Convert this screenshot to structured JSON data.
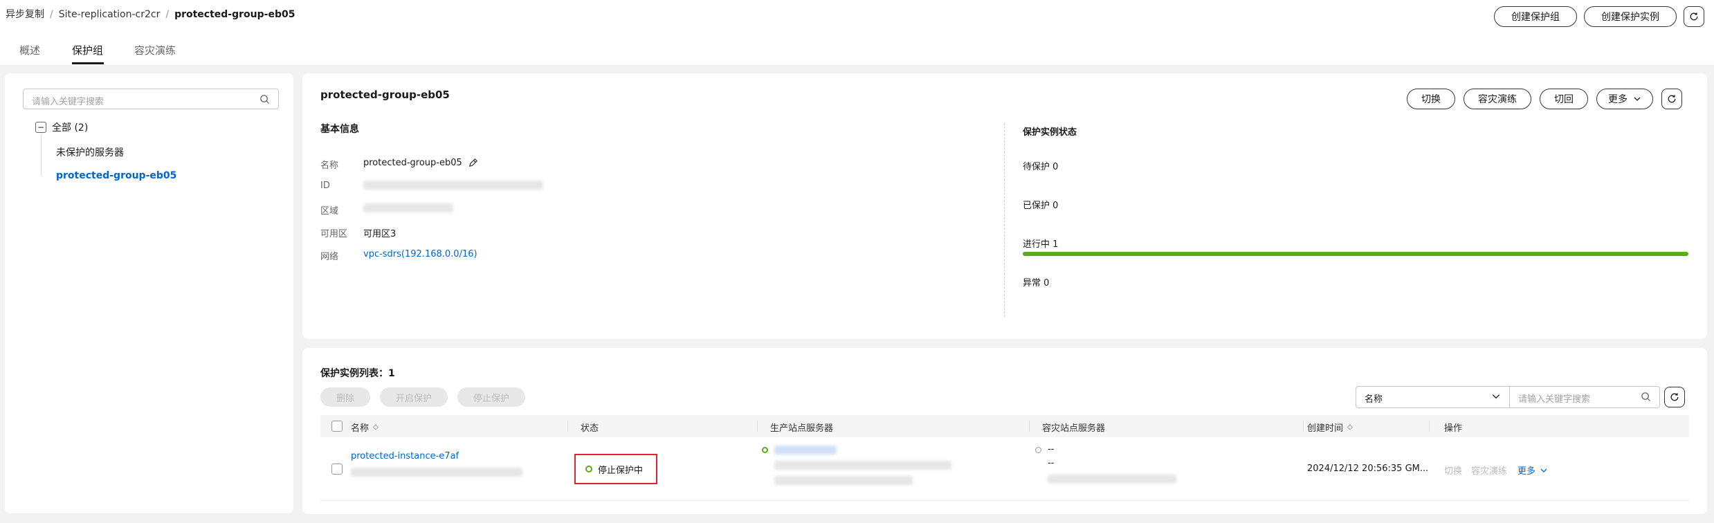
{
  "breadcrumb": {
    "items": [
      "异步复制",
      "Site-replication-cr2cr",
      "protected-group-eb05"
    ]
  },
  "top_actions": {
    "create_group": "创建保护组",
    "create_instance": "创建保护实例"
  },
  "tabs": [
    "概述",
    "保护组",
    "容灾演练"
  ],
  "left": {
    "search_placeholder": "请输入关键字搜索",
    "tree_root": "全部 (2)",
    "tree_items": [
      "未保护的服务器",
      "protected-group-eb05"
    ]
  },
  "detail": {
    "title": "protected-group-eb05",
    "actions": [
      "切换",
      "容灾演练",
      "切回",
      "更多"
    ],
    "basic_title": "基本信息",
    "labels": [
      "名称",
      "ID",
      "区域",
      "可用区",
      "网络"
    ],
    "name_value": "protected-group-eb05",
    "az_value": "可用区3",
    "network_value": "vpc-sdrs(192.168.0.0/16)",
    "status_title": "保护实例状态",
    "stats": {
      "pending": "待保护 0",
      "protected": "已保护 0",
      "in_progress": "进行中 1",
      "error": "异常 0"
    },
    "progress_fraction": 1.0,
    "progress_color": "#5aab19"
  },
  "list": {
    "title": "保护实例列表：1",
    "actions": [
      "删除",
      "开启保护",
      "停止保护"
    ],
    "filter_option": "名称",
    "filter_placeholder": "请输入关键字搜索",
    "columns": [
      "名称",
      "状态",
      "生产站点服务器",
      "容灾站点服务器",
      "创建时间",
      "操作"
    ],
    "rows": [
      {
        "name": "protected-instance-e7af",
        "status": "停止保护中",
        "dr_server_line1": "--",
        "dr_server_line2": "--",
        "created": "2024/12/12 20:56:35 GM...",
        "op_switch": "切换",
        "op_drill": "容灾演练",
        "op_more": "更多"
      }
    ]
  },
  "colors": {
    "link": "#0066cc",
    "status_ok": "#5aab19",
    "highlight": "#e0242c"
  }
}
